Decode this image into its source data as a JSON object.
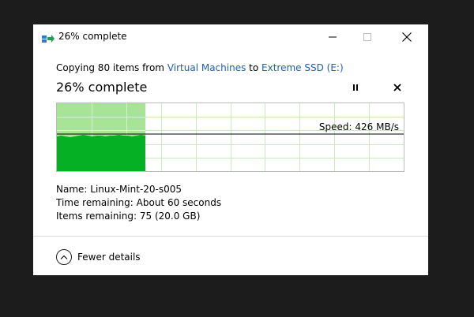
{
  "window": {
    "title": "26% complete",
    "icon": "copy-arrows-icon"
  },
  "copy": {
    "prefix": "Copying 80 items from ",
    "source": "Virtual Machines",
    "middle": " to ",
    "destination": "Extreme SSD (E:)"
  },
  "heading": "26% complete",
  "progress": {
    "percent": 26
  },
  "speed": {
    "label": "Speed: 426 MB/s"
  },
  "details": {
    "name_label": "Name:",
    "name_value": "Linux-Mint-20-s005",
    "time_label": "Time remaining:",
    "time_value": "About 60 seconds",
    "items_label": "Items remaining:",
    "items_value": "75 (20.0 GB)"
  },
  "footer": {
    "fewer_details": "Fewer details"
  },
  "colors": {
    "accent_link": "#1f5fb4",
    "graph_fill_dark": "#06b025",
    "graph_fill_light": "#a8e495",
    "graph_grid": "#cbe9c0"
  }
}
